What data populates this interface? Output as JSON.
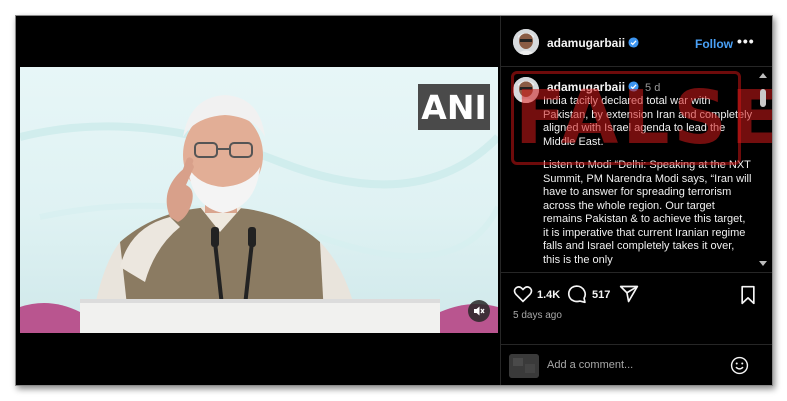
{
  "video": {
    "logo_text": "ANI"
  },
  "post": {
    "username": "adamugarbaii",
    "follow_label": "Follow",
    "more_label": "•••"
  },
  "caption": {
    "username": "adamugarbaii",
    "time": "5 d",
    "paragraph1": "India tacitly declared total war with Pakistan, by extension Iran and completely aligned with Israel agenda to lead the Middle East.",
    "paragraph2": "Listen to Modi “Delhi: Speaking at the NXT Summit, PM Narendra Modi says, “Iran will have to answer for spreading terrorism across the whole region. Our target remains Pakistan & to achieve this target, it is imperative that current Iranian regime falls and Israel completely takes it over, this is the only"
  },
  "stamp": {
    "text": "FALSE"
  },
  "actions": {
    "likes": "1.4K",
    "comments": "517",
    "posted_ago": "5 days ago"
  },
  "comment_box": {
    "placeholder": "Add a comment..."
  },
  "colors": {
    "accent": "#4aa0f5",
    "stamp": "#d21919",
    "background": "#000000"
  },
  "icons": [
    "heart-icon",
    "comment-icon",
    "share-icon",
    "bookmark-icon",
    "emoji-icon",
    "mute-icon",
    "verified-icon"
  ]
}
